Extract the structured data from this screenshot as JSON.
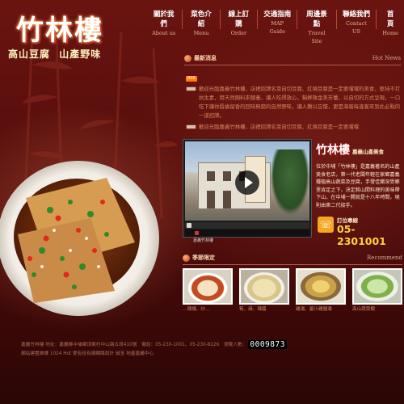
{
  "logo": {
    "name": "竹林樓",
    "slogan_1": "高山豆腐",
    "slogan_2": "山產野味"
  },
  "nav": [
    {
      "zh": "關於我們",
      "en": "About us"
    },
    {
      "zh": "菜色介紹",
      "en": "Menu"
    },
    {
      "zh": "線上訂購",
      "en": "Order"
    },
    {
      "zh": "交通指南",
      "en": "MAP Guide"
    },
    {
      "zh": "周邊景點",
      "en": "Travel Site"
    },
    {
      "zh": "聯絡我們",
      "en": "Contact US"
    },
    {
      "zh": "首 頁",
      "en": "Home"
    }
  ],
  "news": {
    "title": "最新消息",
    "en": "Hot News",
    "badge": "RSS",
    "items": [
      "歡迎光臨嘉義竹林樓，店裡招牌名菜自切豆腐、紅燒豆腐是一定要嚐嚐的美食，堅持不打抗生素，用天然飼料來餵養，讓人吃得放心，稱鮮珠金美芳蕾，以自切的方式呈現，一口吃下讓你唇齒留香的回味無窮的自然野味，讓人難以忘懷，更是海報每逢客來到此必點的一道招牌。",
      "歡迎光臨嘉義竹林樓，店裡招牌名菜自切豆腐、紅燒豆腐是一定要嚐嚐"
    ]
  },
  "video": {
    "caption": "嘉義竹林樓"
  },
  "about": {
    "title": "竹林樓",
    "subtitle": "嘉義山產美食",
    "text": "位於中埔「竹林樓」是嘉義著名的山產美食老店，第一代老闆年輕在家鄉嘉義種植高山蔬菜及豆腐，手發佳餚深受鄉里肯定之下，決定將山間料理的美味帶下山，在中埔一開就是十八年時間，現則由第二代接手。"
  },
  "phone": {
    "label": "訂位專線",
    "number": "05-2301001"
  },
  "seasonal": {
    "title": "季節限定",
    "en": "Recommend",
    "items": [
      {
        "caption": "…辣燒、炒…"
      },
      {
        "caption": "筍、麻、辣醬"
      },
      {
        "caption": "雞湯、薑汁雞腿湯"
      },
      {
        "caption": "高山蔬菜類"
      }
    ]
  },
  "footer": {
    "line1": "嘉義竹林樓 地址：嘉義縣中埔鄉頂東村中山路五段410號　電話：05-230-1001、05-230-8226　瀏覽人數：",
    "counter": "0009873",
    "line2": "網站建置維護 1024 Hot 愛有佳有網網路設計 誠至 地產嘉義中心"
  }
}
